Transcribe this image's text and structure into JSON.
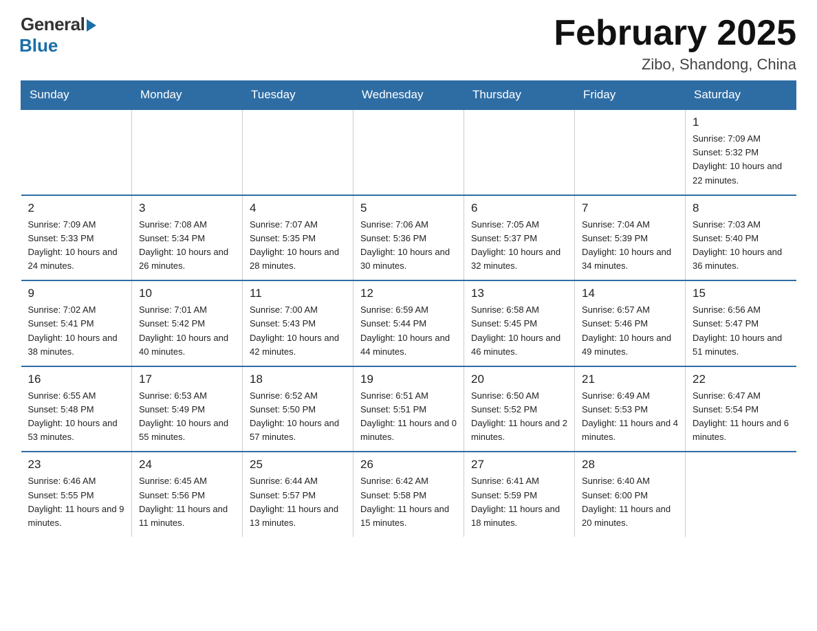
{
  "header": {
    "logo_general": "General",
    "logo_blue": "Blue",
    "title": "February 2025",
    "location": "Zibo, Shandong, China"
  },
  "weekdays": [
    "Sunday",
    "Monday",
    "Tuesday",
    "Wednesday",
    "Thursday",
    "Friday",
    "Saturday"
  ],
  "weeks": [
    [
      {
        "day": "",
        "info": ""
      },
      {
        "day": "",
        "info": ""
      },
      {
        "day": "",
        "info": ""
      },
      {
        "day": "",
        "info": ""
      },
      {
        "day": "",
        "info": ""
      },
      {
        "day": "",
        "info": ""
      },
      {
        "day": "1",
        "info": "Sunrise: 7:09 AM\nSunset: 5:32 PM\nDaylight: 10 hours and 22 minutes."
      }
    ],
    [
      {
        "day": "2",
        "info": "Sunrise: 7:09 AM\nSunset: 5:33 PM\nDaylight: 10 hours and 24 minutes."
      },
      {
        "day": "3",
        "info": "Sunrise: 7:08 AM\nSunset: 5:34 PM\nDaylight: 10 hours and 26 minutes."
      },
      {
        "day": "4",
        "info": "Sunrise: 7:07 AM\nSunset: 5:35 PM\nDaylight: 10 hours and 28 minutes."
      },
      {
        "day": "5",
        "info": "Sunrise: 7:06 AM\nSunset: 5:36 PM\nDaylight: 10 hours and 30 minutes."
      },
      {
        "day": "6",
        "info": "Sunrise: 7:05 AM\nSunset: 5:37 PM\nDaylight: 10 hours and 32 minutes."
      },
      {
        "day": "7",
        "info": "Sunrise: 7:04 AM\nSunset: 5:39 PM\nDaylight: 10 hours and 34 minutes."
      },
      {
        "day": "8",
        "info": "Sunrise: 7:03 AM\nSunset: 5:40 PM\nDaylight: 10 hours and 36 minutes."
      }
    ],
    [
      {
        "day": "9",
        "info": "Sunrise: 7:02 AM\nSunset: 5:41 PM\nDaylight: 10 hours and 38 minutes."
      },
      {
        "day": "10",
        "info": "Sunrise: 7:01 AM\nSunset: 5:42 PM\nDaylight: 10 hours and 40 minutes."
      },
      {
        "day": "11",
        "info": "Sunrise: 7:00 AM\nSunset: 5:43 PM\nDaylight: 10 hours and 42 minutes."
      },
      {
        "day": "12",
        "info": "Sunrise: 6:59 AM\nSunset: 5:44 PM\nDaylight: 10 hours and 44 minutes."
      },
      {
        "day": "13",
        "info": "Sunrise: 6:58 AM\nSunset: 5:45 PM\nDaylight: 10 hours and 46 minutes."
      },
      {
        "day": "14",
        "info": "Sunrise: 6:57 AM\nSunset: 5:46 PM\nDaylight: 10 hours and 49 minutes."
      },
      {
        "day": "15",
        "info": "Sunrise: 6:56 AM\nSunset: 5:47 PM\nDaylight: 10 hours and 51 minutes."
      }
    ],
    [
      {
        "day": "16",
        "info": "Sunrise: 6:55 AM\nSunset: 5:48 PM\nDaylight: 10 hours and 53 minutes."
      },
      {
        "day": "17",
        "info": "Sunrise: 6:53 AM\nSunset: 5:49 PM\nDaylight: 10 hours and 55 minutes."
      },
      {
        "day": "18",
        "info": "Sunrise: 6:52 AM\nSunset: 5:50 PM\nDaylight: 10 hours and 57 minutes."
      },
      {
        "day": "19",
        "info": "Sunrise: 6:51 AM\nSunset: 5:51 PM\nDaylight: 11 hours and 0 minutes."
      },
      {
        "day": "20",
        "info": "Sunrise: 6:50 AM\nSunset: 5:52 PM\nDaylight: 11 hours and 2 minutes."
      },
      {
        "day": "21",
        "info": "Sunrise: 6:49 AM\nSunset: 5:53 PM\nDaylight: 11 hours and 4 minutes."
      },
      {
        "day": "22",
        "info": "Sunrise: 6:47 AM\nSunset: 5:54 PM\nDaylight: 11 hours and 6 minutes."
      }
    ],
    [
      {
        "day": "23",
        "info": "Sunrise: 6:46 AM\nSunset: 5:55 PM\nDaylight: 11 hours and 9 minutes."
      },
      {
        "day": "24",
        "info": "Sunrise: 6:45 AM\nSunset: 5:56 PM\nDaylight: 11 hours and 11 minutes."
      },
      {
        "day": "25",
        "info": "Sunrise: 6:44 AM\nSunset: 5:57 PM\nDaylight: 11 hours and 13 minutes."
      },
      {
        "day": "26",
        "info": "Sunrise: 6:42 AM\nSunset: 5:58 PM\nDaylight: 11 hours and 15 minutes."
      },
      {
        "day": "27",
        "info": "Sunrise: 6:41 AM\nSunset: 5:59 PM\nDaylight: 11 hours and 18 minutes."
      },
      {
        "day": "28",
        "info": "Sunrise: 6:40 AM\nSunset: 6:00 PM\nDaylight: 11 hours and 20 minutes."
      },
      {
        "day": "",
        "info": ""
      }
    ]
  ]
}
